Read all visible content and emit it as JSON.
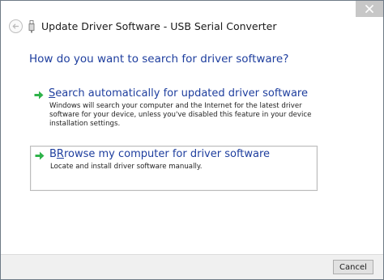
{
  "window": {
    "title": "Update Driver Software - USB Serial Converter"
  },
  "main": {
    "heading": "How do you want to search for driver software?",
    "options": [
      {
        "title_accel": "S",
        "title_rest": "earch automatically for updated driver software",
        "description": "Windows will search your computer and the Internet for the latest driver software for your device, unless you've disabled this feature in your device installation settings."
      },
      {
        "title_accel": "R",
        "title_rest": "rowse my computer for driver software",
        "title_prefix": "B",
        "description": "Locate and install driver software manually."
      }
    ]
  },
  "footer": {
    "cancel_label": "Cancel"
  },
  "icons": {
    "close": "close-icon",
    "back": "back-arrow-icon",
    "device": "usb-device-icon",
    "option_arrow": "green-arrow-icon"
  },
  "colors": {
    "link_blue": "#1e3e9e",
    "arrow_green": "#2fb34a",
    "close_bg": "#c7c7c7"
  }
}
